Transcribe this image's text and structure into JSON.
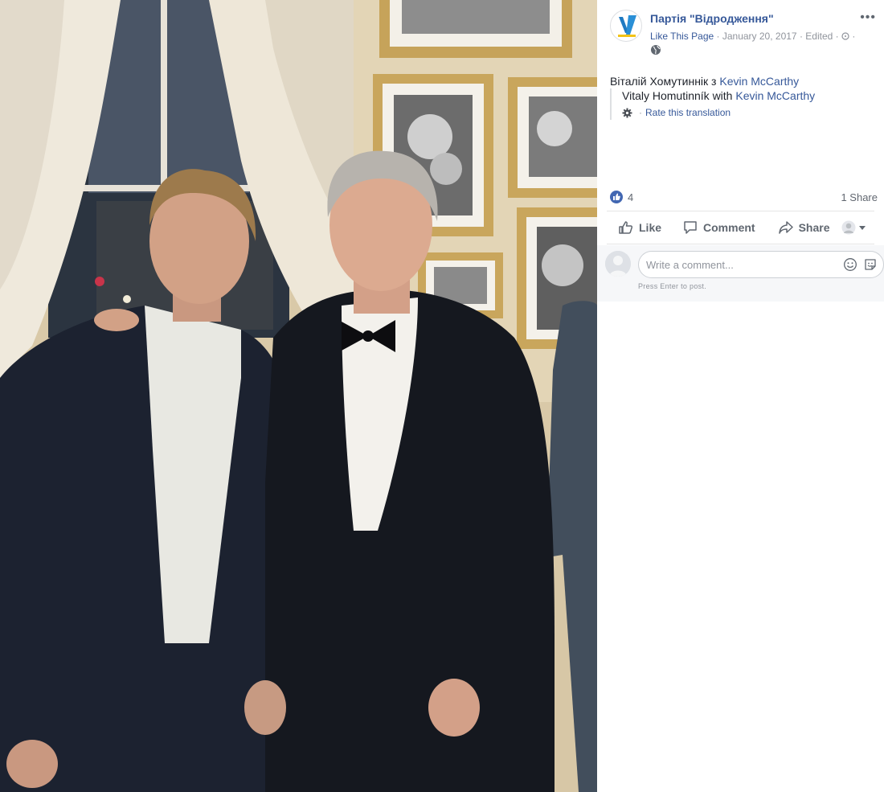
{
  "post": {
    "page_name": "Партія \"Відродження\"",
    "like_link": "Like This Page",
    "meta_sep": "·",
    "date": "January 20, 2017",
    "edited": "Edited",
    "text_prefix": "Віталій Хомутиннік з",
    "mention": "Kevin McCarthy",
    "translation_prefix": "Vitaly Homutinník with",
    "translation_mention": "Kevin McCarthy",
    "rate_translation": "Rate this translation"
  },
  "stats": {
    "reactions_count": "4",
    "shares": "1 Share"
  },
  "actions": {
    "like": "Like",
    "comment": "Comment",
    "share": "Share"
  },
  "comment_box": {
    "placeholder": "Write a comment...",
    "hint": "Press Enter to post."
  },
  "colors": {
    "link": "#365899",
    "like_blue": "#4267b2",
    "muted": "#90949c",
    "brand_avatar": "#1f7ac2"
  },
  "icons": [
    "globe-icon",
    "more-icon",
    "gear-icon",
    "like-reaction-icon",
    "thumbs-up-icon",
    "comment-icon",
    "share-icon",
    "caret-down-icon",
    "emoji-icon",
    "sticker-icon"
  ]
}
